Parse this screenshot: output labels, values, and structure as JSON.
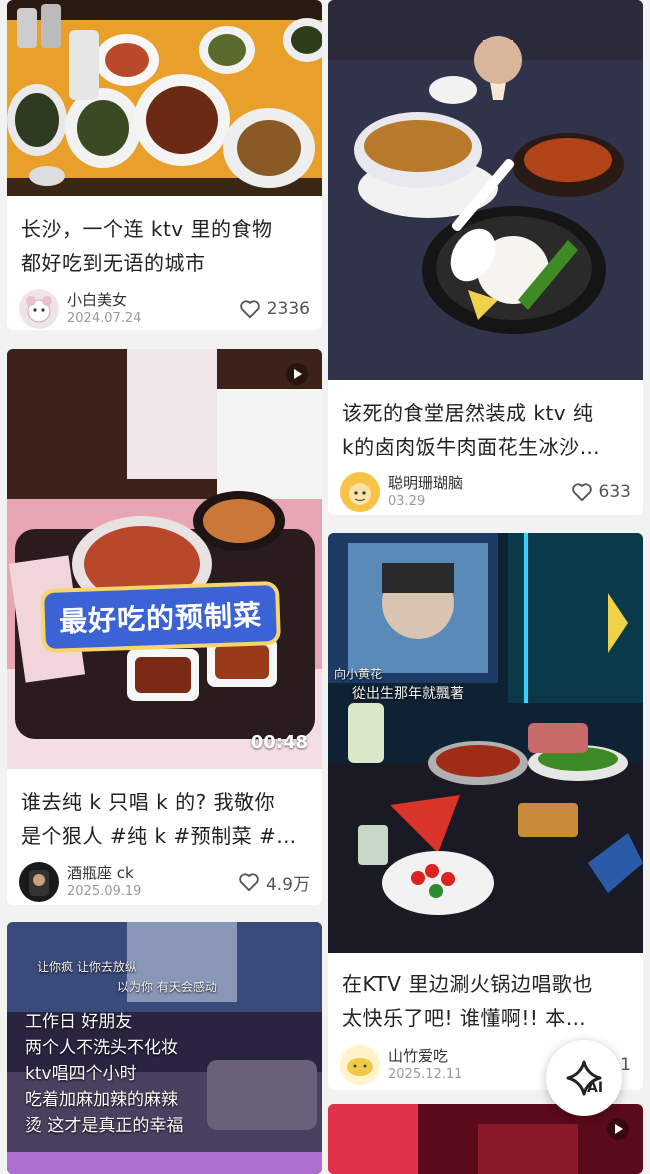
{
  "cards": {
    "c1": {
      "title_line1": "长沙，一个连 ktv 里的食物",
      "title_line2": "都好吃到无语的城市",
      "author": "小白美女",
      "date": "2024.07.24",
      "likes": "2336"
    },
    "c2": {
      "title_line1": "该死的食堂居然装成 ktv 纯",
      "title_line2": "k的卤肉饭牛肉面花生冰沙…",
      "author": "聪明珊瑚脑",
      "date": "03.29",
      "likes": "633"
    },
    "c3": {
      "overlay": "最好吃的预制菜",
      "duration": "00:48",
      "title_line1": "谁去纯 k 只唱 k 的? 我敬你",
      "title_line2": "是个狠人 #纯 k #预制菜 #…",
      "author": "酒瓶座 ck",
      "date": "2025.09.19",
      "likes": "4.9万"
    },
    "c4": {
      "tv_text1": "從出生那年就飄著",
      "tv_text2": "向小黄花",
      "title_line1": "在KTV 里边涮火锅边唱歌也",
      "title_line2": "太快乐了吧! 谁懂啊!! 本…",
      "author": "山竹爱吃",
      "date": "2025.12.11",
      "likes": "1"
    },
    "c5": {
      "lyric1": "让你疯 让你去放纵",
      "lyric2": "以为你 有天会感动",
      "caption": [
        "工作日 好朋友",
        "两个人不洗头不化妆",
        "ktv唱四个小时",
        "吃着加麻加辣的麻辣",
        "烫  这才是真正的幸福"
      ]
    }
  },
  "ai_button": {
    "label": "AI"
  },
  "colors": {
    "heart": "#555555",
    "card_bg": "#ffffff",
    "page_bg": "#f2f2f2"
  }
}
